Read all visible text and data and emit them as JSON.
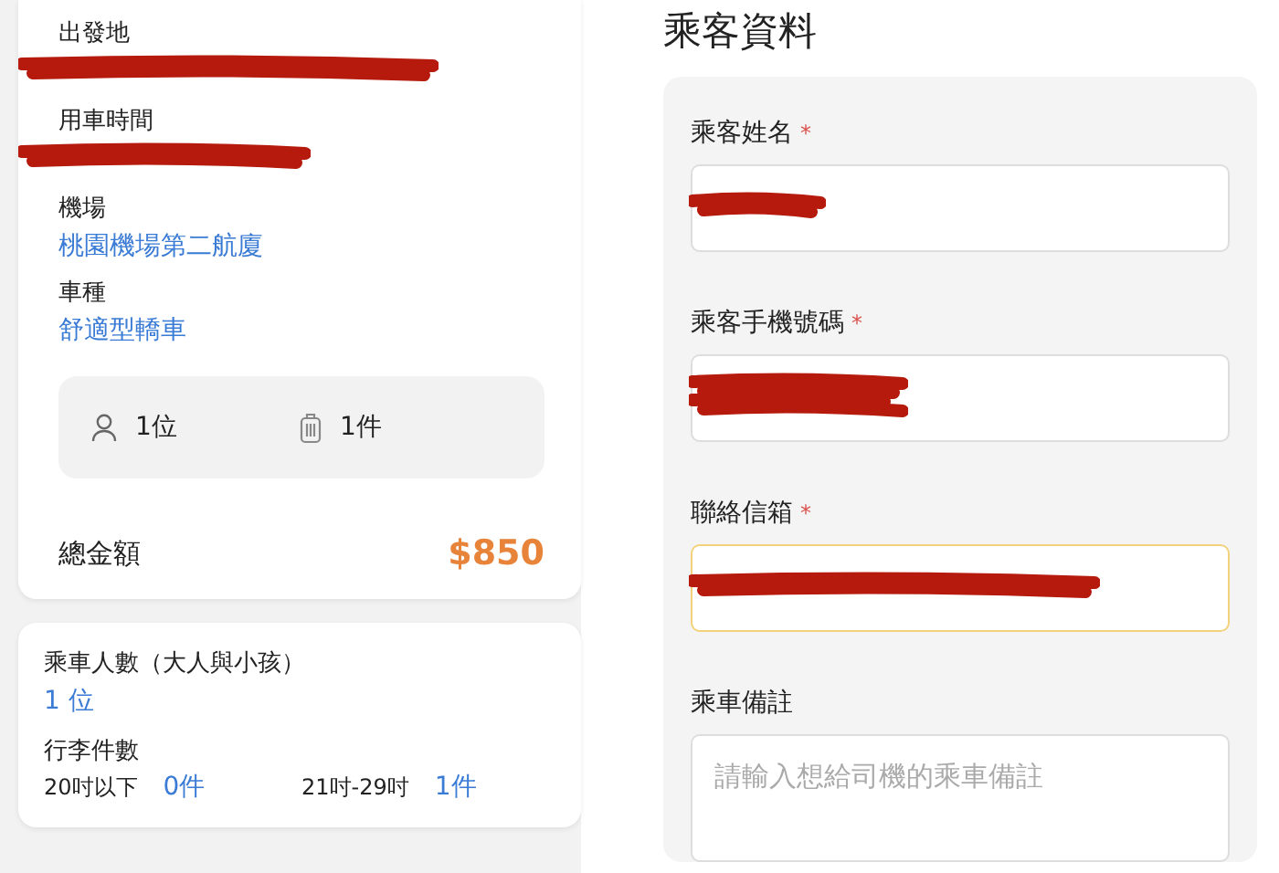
{
  "trip_card": {
    "details": [
      {
        "label": "出發地",
        "redacted": true
      },
      {
        "label": "用車時間",
        "redacted": true
      },
      {
        "label": "機場",
        "value": "桃園機場第二航廈"
      },
      {
        "label": "車種",
        "value": "舒適型轎車"
      }
    ],
    "counts": [
      {
        "kind": "person",
        "text": "1位"
      },
      {
        "kind": "luggage",
        "text": "1件"
      }
    ],
    "total": {
      "label": "總金額",
      "amount": "$850"
    }
  },
  "passenger_card": {
    "count_label": "乘車人數（大人與小孩）",
    "count_value": "1 位",
    "luggage_label": "行李件數",
    "luggage": [
      {
        "size": "20吋以下",
        "count": "0件"
      },
      {
        "size": "21吋-29吋",
        "count": "1件"
      }
    ]
  },
  "passenger_form": {
    "title": "乘客資料",
    "fields": [
      {
        "kind": "input",
        "label": "乘客姓名",
        "required_mark": "*",
        "redacted": true,
        "focused": false
      },
      {
        "kind": "input",
        "label": "乘客手機號碼",
        "required_mark": "*",
        "redacted": true,
        "focused": false
      },
      {
        "kind": "input",
        "label": "聯絡信箱",
        "required_mark": "*",
        "redacted": true,
        "focused": true
      },
      {
        "kind": "textarea",
        "label": "乘車備註",
        "placeholder": "請輸入想給司機的乘車備註",
        "focused": false
      }
    ]
  }
}
